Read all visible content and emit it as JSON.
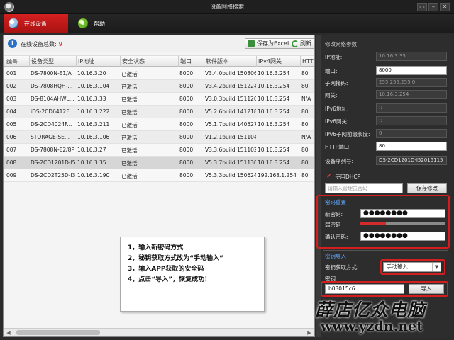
{
  "window": {
    "title": "设备网络搜索",
    "buttons": [
      "▭",
      "–",
      "✕"
    ]
  },
  "tabs": [
    {
      "label": "在线设备",
      "active": true,
      "icon": "search-device-icon"
    },
    {
      "label": "帮助",
      "active": false,
      "icon": "help-icon",
      "glyph": "i"
    }
  ],
  "infobar": {
    "total_label": "在线设备总数:",
    "total_count": "9",
    "export_label": "保存为Excel",
    "refresh_label": "刷新"
  },
  "table": {
    "columns": [
      "编号",
      "设备类型",
      "IP地址",
      "安全状态",
      "端口",
      "软件版本",
      "IPv4网关",
      "HTT"
    ],
    "rows": [
      [
        "001",
        "DS-7800N-E1/A",
        "10.16.3.20",
        "已激活",
        "8000",
        "V3.4.0build 150806",
        "10.16.3.254",
        "80"
      ],
      [
        "002",
        "DS-7808HQH-...",
        "10.16.3.104",
        "已激活",
        "8000",
        "V3.4.2build 151224",
        "10.16.3.254",
        "80"
      ],
      [
        "003",
        "DS-8104AHWL...",
        "10.16.3.33",
        "已激活",
        "8000",
        "V3.0.3build 151120",
        "10.16.3.254",
        "N/A"
      ],
      [
        "004",
        "iDS-2CD6412F...",
        "10.16.3.222",
        "已激活",
        "8000",
        "V5.2.6build 141218",
        "10.16.3.254",
        "80"
      ],
      [
        "005",
        "DS-2CD4024F...",
        "10.16.3.211",
        "已激活",
        "8000",
        "V5.1.7build 140527",
        "10.16.3.254",
        "80"
      ],
      [
        "006",
        "STORAGE-SE...",
        "10.16.3.106",
        "已激活",
        "8000",
        "V1.2.1build 151104",
        "",
        "N/A"
      ],
      [
        "007",
        "DS-7808N-E2/8P",
        "10.16.3.27",
        "已激活",
        "8000",
        "V3.3.6build 151102",
        "10.16.3.254",
        "80"
      ],
      [
        "008",
        "DS-2CD1201D-I5",
        "10.16.3.35",
        "已激活",
        "8000",
        "V5.3.7build 151130",
        "10.16.3.254",
        "80"
      ],
      [
        "009",
        "DS-2CD2T25D-I3",
        "10.16.3.190",
        "已激活",
        "8000",
        "V5.3.3build 150624",
        "192.168.1.254",
        "80"
      ]
    ],
    "selected_row_index": 7
  },
  "note": {
    "lines": [
      "1，输入新密码方式",
      "2，秘钥获取方式改为“手动输入”",
      "3，输入APP获取的安全码",
      "4，点击“导入”，恢复成功！"
    ]
  },
  "panel": {
    "section_title": "修改网络参数",
    "fields": [
      {
        "label": "IP地址:",
        "value": "10.16.3.35"
      },
      {
        "label": "端口:",
        "value": "8000"
      },
      {
        "label": "子网掩码:",
        "value": "255.255.255.0"
      },
      {
        "label": "网关:",
        "value": "10.16.3.254"
      },
      {
        "label": "IPv6地址:",
        "value": "::"
      },
      {
        "label": "IPv6网关:",
        "value": "::"
      },
      {
        "label": "IPv6子网前缀长度:",
        "value": "0"
      },
      {
        "label": "HTTP端口:",
        "value": "80"
      },
      {
        "label": "设备序列号:",
        "value": "DS-2CD1201D-I52015115"
      }
    ],
    "dhcp_label": "使用DHCP",
    "admin_pwd_placeholder": "请输入管理员密码",
    "save_label": "保存修改",
    "reset_title": "密码重置",
    "new_pwd_label": "新密码:",
    "new_pwd_value": "●●●●●●●●",
    "strength_label": "弱密码",
    "strength_level": 0.3,
    "confirm_pwd_label": "确认密码:",
    "confirm_pwd_value": "●●●●●●●●",
    "import_title": "密钥导入",
    "key_method_label": "密钥获取方式:",
    "key_method_value": "手动输入",
    "key_label": "密钥",
    "key_value": "b03015c6",
    "import_label": "导入"
  },
  "watermark": {
    "line1": "薛店亿众电脑",
    "line2": "www.yzdn.net"
  },
  "colors": {
    "accent_red": "#d21e1e",
    "tab_active": "#c41a1a",
    "panel_bg": "#2d2d2d"
  }
}
